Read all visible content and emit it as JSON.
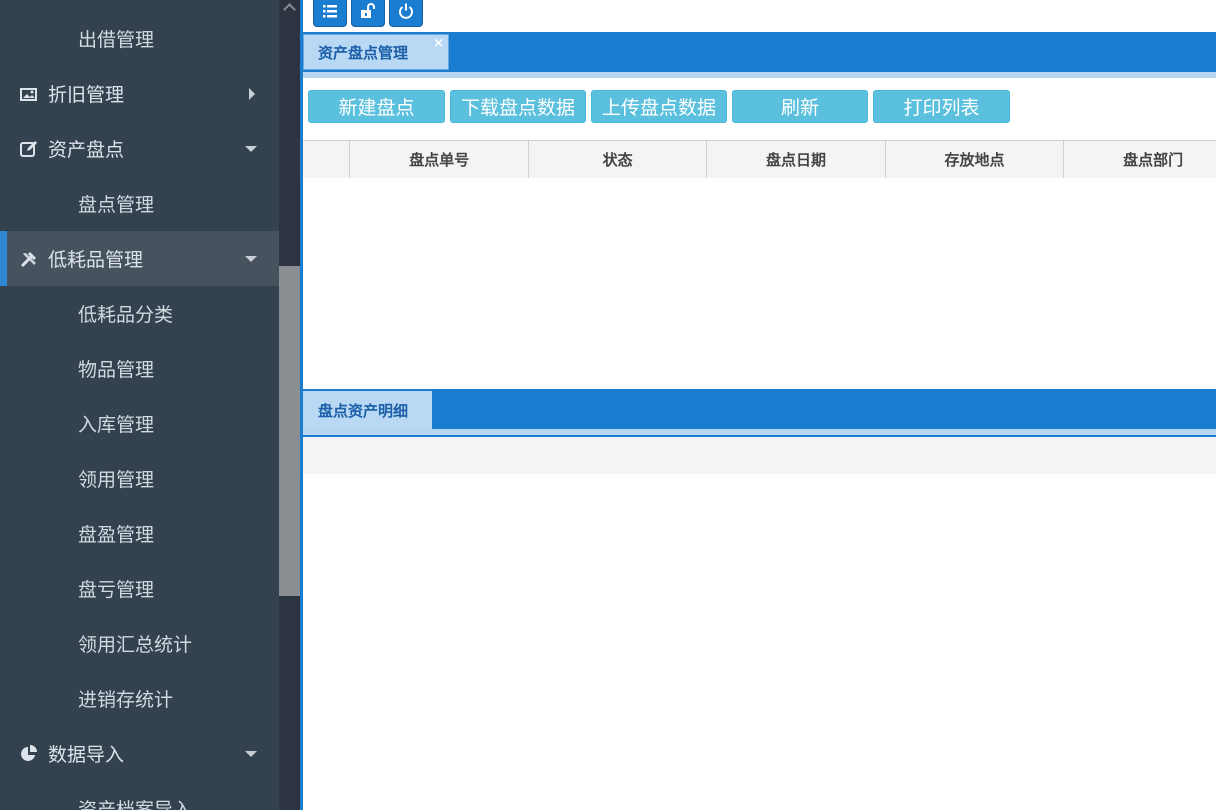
{
  "sidebar": {
    "items": [
      {
        "label": "出借管理",
        "type": "sub"
      },
      {
        "label": "折旧管理",
        "type": "parent",
        "icon": "image-icon",
        "arrow": "right"
      },
      {
        "label": "资产盘点",
        "type": "parent",
        "icon": "edit-icon",
        "arrow": "down"
      },
      {
        "label": "盘点管理",
        "type": "sub"
      },
      {
        "label": "低耗品管理",
        "type": "parent",
        "icon": "tools-icon",
        "arrow": "down",
        "active": true
      },
      {
        "label": "低耗品分类",
        "type": "sub"
      },
      {
        "label": "物品管理",
        "type": "sub"
      },
      {
        "label": "入库管理",
        "type": "sub"
      },
      {
        "label": "领用管理",
        "type": "sub"
      },
      {
        "label": "盘盈管理",
        "type": "sub"
      },
      {
        "label": "盘亏管理",
        "type": "sub"
      },
      {
        "label": "领用汇总统计",
        "type": "sub"
      },
      {
        "label": "进销存统计",
        "type": "sub"
      },
      {
        "label": "数据导入",
        "type": "parent",
        "icon": "pie-chart-icon",
        "arrow": "down"
      },
      {
        "label": "资产档案导入",
        "type": "sub"
      }
    ]
  },
  "toolbar": {
    "buttons": [
      {
        "icon": "list-icon"
      },
      {
        "icon": "unlock-icon"
      },
      {
        "icon": "power-icon"
      }
    ]
  },
  "tabs": {
    "main_tab": "资产盘点管理",
    "close_glyph": "×",
    "detail_tab": "盘点资产明细"
  },
  "actions": [
    "新建盘点",
    "下载盘点数据",
    "上传盘点数据",
    "刷新",
    "打印列表"
  ],
  "table": {
    "columns": [
      "盘点单号",
      "状态",
      "盘点日期",
      "存放地点",
      "盘点部门"
    ]
  },
  "colors": {
    "sidebar_bg": "#34414f",
    "accent": "#1a7dd0",
    "button": "#5bc0de"
  }
}
